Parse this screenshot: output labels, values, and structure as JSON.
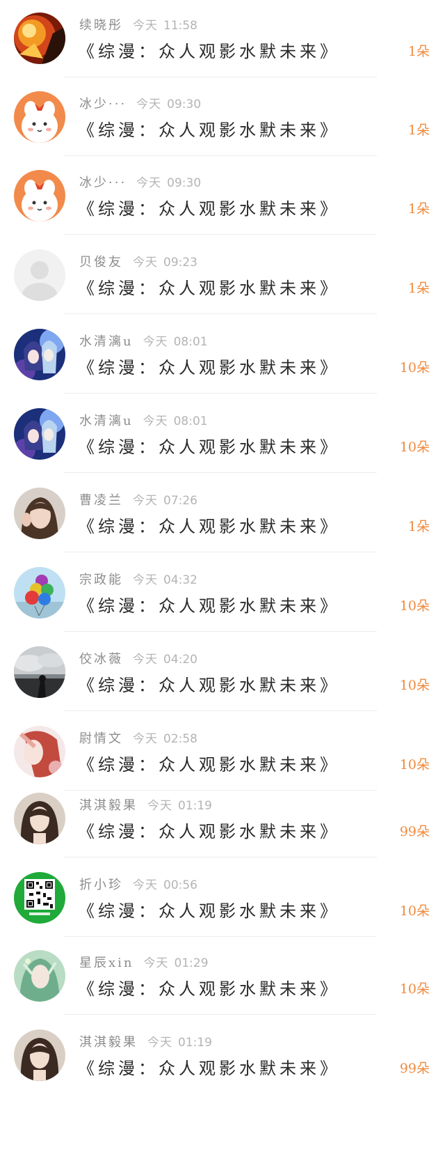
{
  "feed": {
    "items": [
      {
        "name": "续晓彤",
        "day": "今天",
        "time": "11:58",
        "title": "《综漫：众人观影水默未来》",
        "gift": "1朵",
        "avatar": "fire-ninja-avatar"
      },
      {
        "name": "冰少···",
        "day": "今天",
        "time": "09:30",
        "title": "《综漫：众人观影水默未来》",
        "gift": "1朵",
        "avatar": "cartoon-bunny-avatar"
      },
      {
        "name": "冰少···",
        "day": "今天",
        "time": "09:30",
        "title": "《综漫：众人观影水默未来》",
        "gift": "1朵",
        "avatar": "cartoon-bunny-avatar"
      },
      {
        "name": "贝俊友",
        "day": "今天",
        "time": "09:23",
        "title": "《综漫：众人观影水默未来》",
        "gift": "1朵",
        "avatar": "default-user-avatar"
      },
      {
        "name": "水清漓u",
        "day": "今天",
        "time": "08:01",
        "title": "《综漫：众人观影水默未来》",
        "gift": "10朵",
        "avatar": "anime-couple-avatar"
      },
      {
        "name": "水清漓u",
        "day": "今天",
        "time": "08:01",
        "title": "《综漫：众人观影水默未来》",
        "gift": "10朵",
        "avatar": "anime-couple-avatar"
      },
      {
        "name": "曹凌兰",
        "day": "今天",
        "time": "07:26",
        "title": "《综漫：众人观影水默未来》",
        "gift": "1朵",
        "avatar": "girl-photo-avatar"
      },
      {
        "name": "宗政能",
        "day": "今天",
        "time": "04:32",
        "title": "《综漫：众人观影水默未来》",
        "gift": "10朵",
        "avatar": "balloons-avatar"
      },
      {
        "name": "佼冰薇",
        "day": "今天",
        "time": "04:20",
        "title": "《综漫：众人观影水默未来》",
        "gift": "10朵",
        "avatar": "cloudy-landscape-avatar"
      },
      {
        "name": "尉情文",
        "day": "今天",
        "time": "02:58",
        "title": "《综漫：众人观影水默未来》",
        "gift": "10朵",
        "avatar": "red-hair-girl-avatar"
      },
      {
        "name": "淇淇毅果",
        "day": "今天",
        "time": "01:19",
        "title": "《综漫：众人观影水默未来》",
        "gift": "99朵",
        "avatar": "dark-hair-girl-avatar"
      },
      {
        "name": "折小珍",
        "day": "今天",
        "time": "00:56",
        "title": "《综漫：众人观影水默未来》",
        "gift": "10朵",
        "avatar": "qr-code-avatar"
      },
      {
        "name": "星辰xin",
        "day": "今天",
        "time": "01:29",
        "title": "《综漫：众人观影水默未来》",
        "gift": "10朵",
        "avatar": "elf-girl-avatar"
      },
      {
        "name": "淇淇毅果",
        "day": "今天",
        "time": "01:19",
        "title": "《综漫：众人观影水默未来》",
        "gift": "99朵",
        "avatar": "dark-hair-girl-avatar"
      }
    ]
  },
  "colors": {
    "gift_accent": "#ef8a3e",
    "title_text": "#2b2b2b",
    "name_text": "#8c8c8c",
    "time_text": "#b4b4b4"
  }
}
